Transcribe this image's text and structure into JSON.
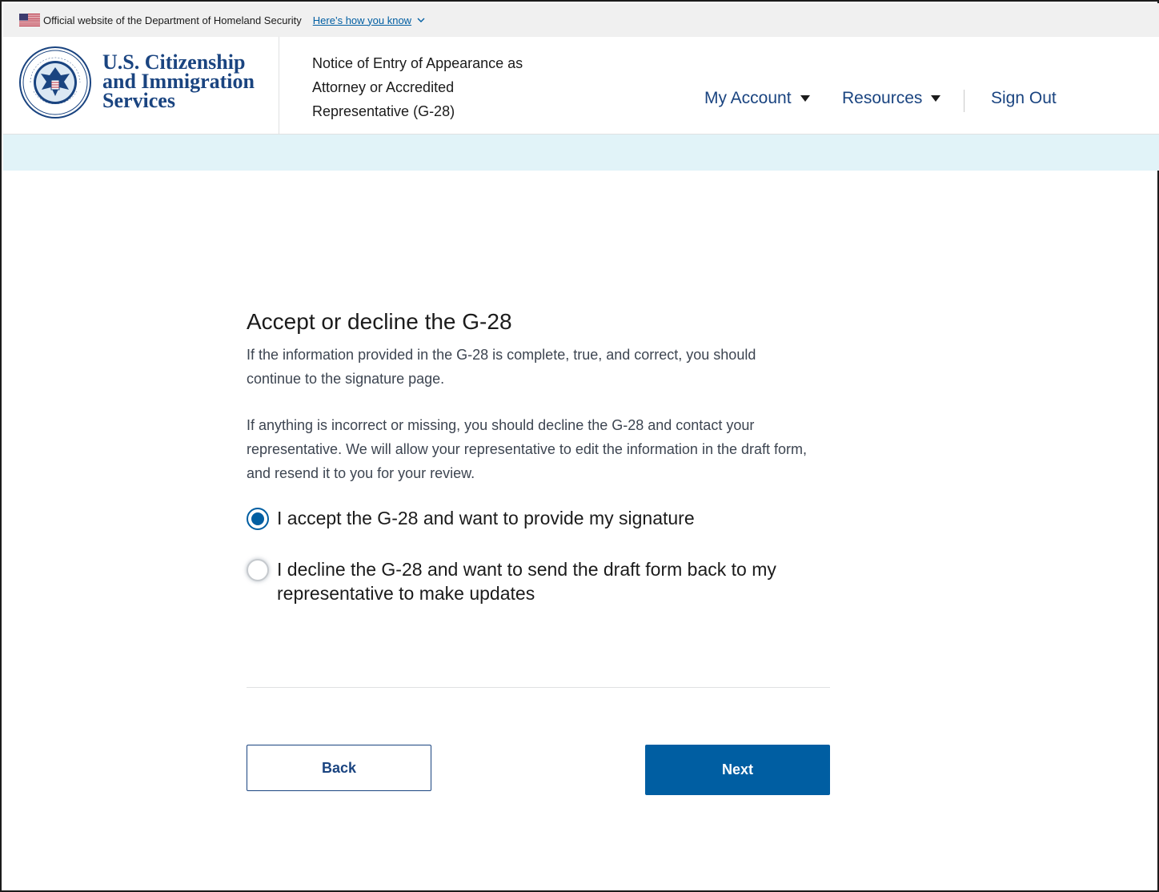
{
  "gov_banner": {
    "official_text": "Official website of the Department of Homeland Security",
    "how_you_know_link": "Here’s how you know"
  },
  "header": {
    "agency_line1": "U.S. Citizenship",
    "agency_line2": "and Immigration",
    "agency_line3": "Services",
    "seal_text": "DEPARTMENT OF HOMELAND SECURITY",
    "form_title": "Notice of Entry of Appearance as Attorney or Accredited Representative (G-28)",
    "nav": {
      "my_account": "My Account",
      "resources": "Resources",
      "sign_out": "Sign Out"
    }
  },
  "main": {
    "title": "Accept or decline the G-28",
    "paragraph1": "If the information provided in the G-28 is complete, true, and correct, you should continue to the signature page.",
    "paragraph2": "If anything is incorrect or missing, you should decline the G-28 and contact your representative. We will allow your representative to edit the information in the draft form, and resend it to you for your review.",
    "options": [
      {
        "label": "I accept the G-28 and want to provide my signature",
        "selected": true
      },
      {
        "label": "I decline the G-28 and want to send the draft form back to my representative to make updates",
        "selected": false
      }
    ],
    "back_label": "Back",
    "next_label": "Next"
  },
  "colors": {
    "primary": "#005ea2",
    "agency_blue": "#1a4480",
    "strip": "#e1f3f8",
    "banner_bg": "#f0f0f0"
  }
}
